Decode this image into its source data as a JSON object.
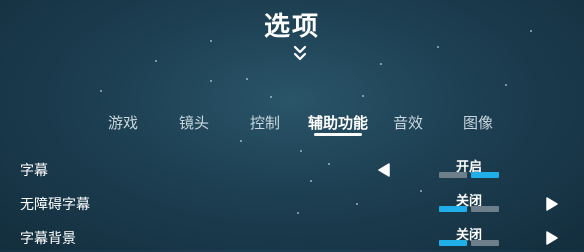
{
  "page": {
    "title": "选项"
  },
  "tabs": [
    {
      "label": "游戏"
    },
    {
      "label": "镜头"
    },
    {
      "label": "控制"
    },
    {
      "label": "辅助功能",
      "active": true
    },
    {
      "label": "音效"
    },
    {
      "label": "图像"
    }
  ],
  "settings": [
    {
      "label": "字幕",
      "value": "开启",
      "selected_index": 1,
      "option_count": 2
    },
    {
      "label": "无障碍字幕",
      "value": "关闭",
      "selected_index": 0,
      "option_count": 2
    },
    {
      "label": "字幕背景",
      "value": "关闭",
      "selected_index": 0,
      "option_count": 2
    }
  ],
  "icons": {
    "expand": "double-chevron-down-icon",
    "prev": "arrow-left-icon",
    "next": "arrow-right-icon"
  },
  "colors": {
    "accent": "#1faee8",
    "inactive_segment": "#6d7f8a"
  }
}
